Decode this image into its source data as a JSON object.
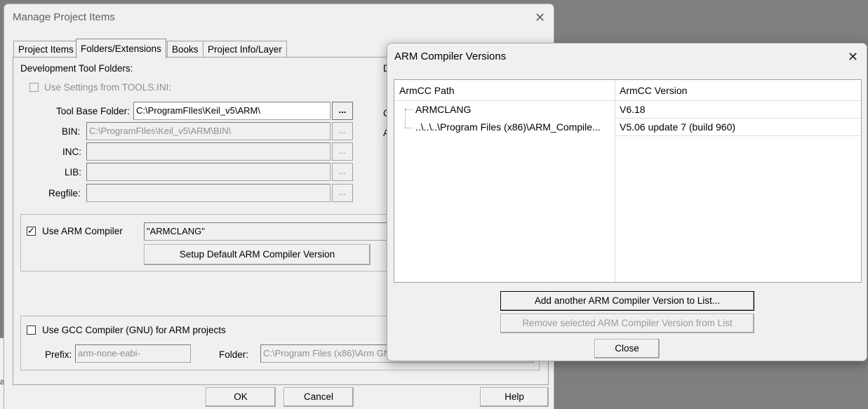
{
  "main_dialog": {
    "title": "Manage Project Items",
    "tabs": [
      "Project Items",
      "Folders/Extensions",
      "Books",
      "Project Info/Layer"
    ],
    "active_tab": "Folders/Extensions",
    "dev_tool_folders_label": "Development Tool Folders:",
    "partial_right_label": "D",
    "partial_c": "C",
    "partial_a": "A",
    "use_settings_label": "Use Settings from TOOLS.INI:",
    "tool_base_folder": {
      "label": "Tool Base Folder:",
      "value": "C:\\ProgramFIles\\Keil_v5\\ARM\\",
      "browse": "..."
    },
    "bin": {
      "label": "BIN:",
      "value": "C:\\ProgramFIles\\Keil_v5\\ARM\\BIN\\",
      "browse": "..."
    },
    "inc": {
      "label": "INC:",
      "value": "",
      "browse": "..."
    },
    "lib": {
      "label": "LIB:",
      "value": "",
      "browse": "..."
    },
    "regfile": {
      "label": "Regfile:",
      "value": "",
      "browse": "..."
    },
    "use_arm_compiler": {
      "label": "Use ARM Compiler",
      "checked": true,
      "value": "\"ARMCLANG\""
    },
    "setup_default_button": "Setup Default ARM Compiler Version",
    "use_gcc": {
      "label": "Use GCC Compiler (GNU) for ARM projects",
      "checked": false
    },
    "prefix": {
      "label": "Prefix:",
      "value": "arm-none-eabi-"
    },
    "folder": {
      "label": "Folder:",
      "value": "C:\\Program Files (x86)\\Arm GN"
    },
    "buttons": {
      "ok": "OK",
      "cancel": "Cancel",
      "help": "Help"
    },
    "bg_partial_text": "a"
  },
  "arm_dialog": {
    "title": "ARM Compiler Versions",
    "columns": [
      "ArmCC Path",
      "ArmCC Version"
    ],
    "rows": [
      {
        "path": "ARMCLANG",
        "version": "V6.18"
      },
      {
        "path": "..\\..\\..\\Program Files (x86)\\ARM_Compile...",
        "version": "V5.06 update 7 (build 960)"
      }
    ],
    "add_button": "Add another ARM Compiler Version to List...",
    "remove_button": "Remove selected ARM Compiler Version from List",
    "close_button": "Close"
  },
  "icons": {
    "close": "close-icon",
    "check": "checkmark-icon"
  }
}
